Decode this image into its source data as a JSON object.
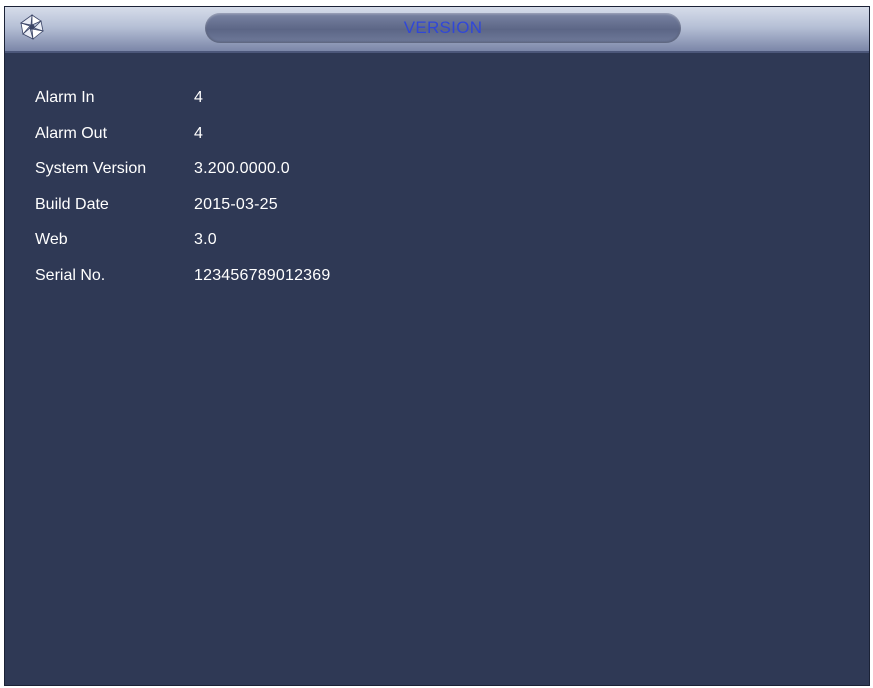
{
  "window": {
    "title": "VERSION",
    "logo_icon": "dahua-logo-icon",
    "accent_color": "#3047d8",
    "background_color": "#2f3955"
  },
  "info": {
    "rows": [
      {
        "label": "Alarm In",
        "value": "4"
      },
      {
        "label": "Alarm Out",
        "value": "4"
      },
      {
        "label": "System Version",
        "value": "3.200.0000.0"
      },
      {
        "label": "Build Date",
        "value": "2015-03-25"
      },
      {
        "label": "Web",
        "value": "3.0"
      },
      {
        "label": "Serial No.",
        "value": "123456789012369"
      }
    ]
  }
}
